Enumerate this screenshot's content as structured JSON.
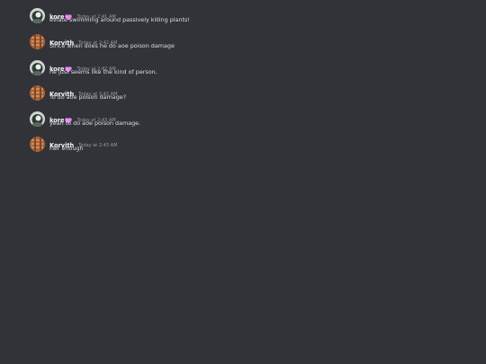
{
  "colors": {
    "background": "#313338",
    "author": "#f2f3f5",
    "timestamp": "#949ba4",
    "text": "#dbdee1",
    "heart": "#f47fff"
  },
  "messages": [
    {
      "author": "kore",
      "author_badge_icon": "sparkling-heart-icon",
      "avatar": "kore-avatar",
      "timestamp": "Today at 2:41 AM",
      "content": "eviate swimming around passively killing plants!"
    },
    {
      "author": "Korvith",
      "author_badge_icon": null,
      "avatar": "korvith-avatar",
      "timestamp": "Today at 2:42 AM",
      "content": "Since when does he do aoe poison damage"
    },
    {
      "author": "kore",
      "author_badge_icon": "sparkling-heart-icon",
      "avatar": "kore-avatar",
      "timestamp": "Today at 2:42 AM",
      "content": "he just seems like the kind of person."
    },
    {
      "author": "Korvith",
      "author_badge_icon": null,
      "avatar": "korvith-avatar",
      "timestamp": "Today at 2:42 AM",
      "content": "To do aoe poison damage?"
    },
    {
      "author": "kore",
      "author_badge_icon": "sparkling-heart-icon",
      "avatar": "kore-avatar",
      "timestamp": "Today at 2:43 AM",
      "content": "yeah to do aoe poison damage."
    },
    {
      "author": "Korvith",
      "author_badge_icon": null,
      "avatar": "korvith-avatar",
      "timestamp": "Today at 2:43 AM",
      "content": "Fair enough"
    }
  ]
}
